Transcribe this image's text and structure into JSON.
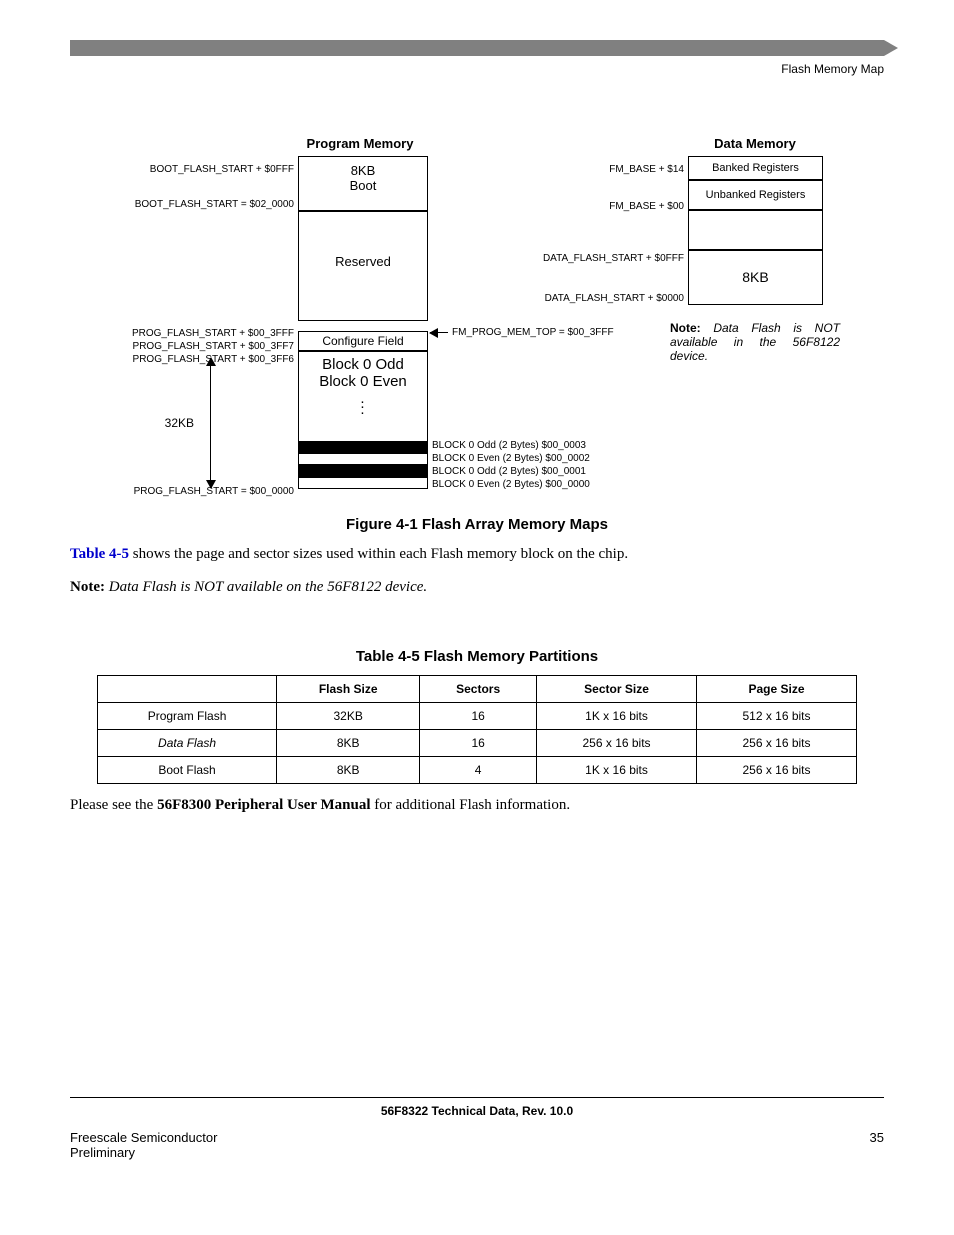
{
  "header": {
    "section": "Flash Memory Map"
  },
  "figure": {
    "caption": "Figure 4-1 Flash Array Memory Maps",
    "prog_mem_title": "Program Memory",
    "data_mem_title": "Data Memory",
    "prog": {
      "boot_top": "BOOT_FLASH_START + $0FFF",
      "boot_base": "BOOT_FLASH_START = $02_0000",
      "boot_block": {
        "size": "8KB",
        "name": "Boot"
      },
      "reserved": "Reserved",
      "cfg_addr1": "PROG_FLASH_START + $00_3FFF",
      "cfg_addr2": "PROG_FLASH_START + $00_3FF7",
      "cfg_addr3": "PROG_FLASH_START + $00_3FF6",
      "cfg_block": "Configure Field",
      "block0_odd": "Block 0 Odd",
      "block0_even": "Block 0 Even",
      "dots": "⋮",
      "size_label": "32KB",
      "base": "PROG_FLASH_START = $00_0000",
      "fm_top": "FM_PROG_MEM_TOP = $00_3FFF",
      "row0": "BLOCK 0 Odd (2 Bytes) $00_0003",
      "row1": "BLOCK 0 Even (2 Bytes) $00_0002",
      "row2": "BLOCK 0 Odd (2 Bytes) $00_0001",
      "row3": "BLOCK 0 Even (2 Bytes) $00_0000"
    },
    "data": {
      "fm_base_14": "FM_BASE + $14",
      "fm_base_00": "FM_BASE + $00",
      "banked": "Banked Registers",
      "unbanked": "Unbanked Registers",
      "flash_top": "DATA_FLASH_START + $0FFF",
      "flash_base": "DATA_FLASH_START + $0000",
      "size": "8KB",
      "note_label": "Note:",
      "note_text": "Data Flash is NOT available in the 56F8122 device."
    }
  },
  "paras": {
    "p1a": "Table 4-5",
    "p1b": " shows the page and sector sizes used within each Flash memory block on the chip.",
    "p2a": "Note:",
    "p2b": "Data Flash is NOT available on the 56F8122 device.",
    "p3a": "Please see the ",
    "p3b": "56F8300 Peripheral User Manual",
    "p3c": " for additional Flash information."
  },
  "table": {
    "caption": "Table 4-5 Flash Memory Partitions",
    "headers": [
      "",
      "Flash Size",
      "Sectors",
      "Sector Size",
      "Page Size"
    ],
    "rows": [
      {
        "name": "Program Flash",
        "ital": false,
        "flash_size": "32KB",
        "sectors": "16",
        "sector_size": "1K x 16 bits",
        "page_size": "512 x 16 bits"
      },
      {
        "name": "Data Flash",
        "ital": true,
        "flash_size": "8KB",
        "sectors": "16",
        "sector_size": "256 x 16 bits",
        "page_size": "256 x 16 bits"
      },
      {
        "name": "Boot Flash",
        "ital": false,
        "flash_size": "8KB",
        "sectors": "4",
        "sector_size": "1K x 16 bits",
        "page_size": "256 x 16 bits"
      }
    ]
  },
  "footer": {
    "rev": "56F8322 Technical Data, Rev. 10.0",
    "left1": "Freescale Semiconductor",
    "left2": "Preliminary",
    "page": "35"
  }
}
